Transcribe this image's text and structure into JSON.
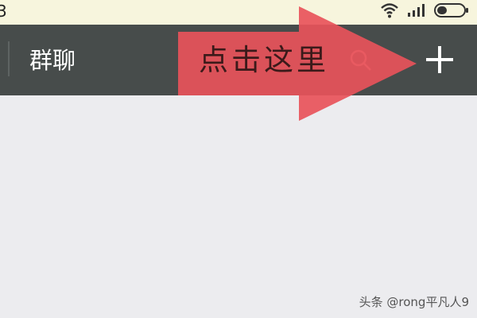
{
  "status_bar": {
    "time_fragment": "3",
    "battery_icon": "battery-icon",
    "signal_icon": "signal-icon",
    "wifi_icon": "wifi-icon"
  },
  "header": {
    "title": "群聊",
    "search_icon": "search-icon",
    "add_icon": "plus-icon"
  },
  "annotation": {
    "text": "点击这里",
    "arrow_color": "#e8525a"
  },
  "watermark": {
    "text": "头条 @rong平凡人9"
  },
  "colors": {
    "header_bg": "#474c4b",
    "status_bg": "#f7f5dd",
    "content_bg": "#ececef"
  }
}
